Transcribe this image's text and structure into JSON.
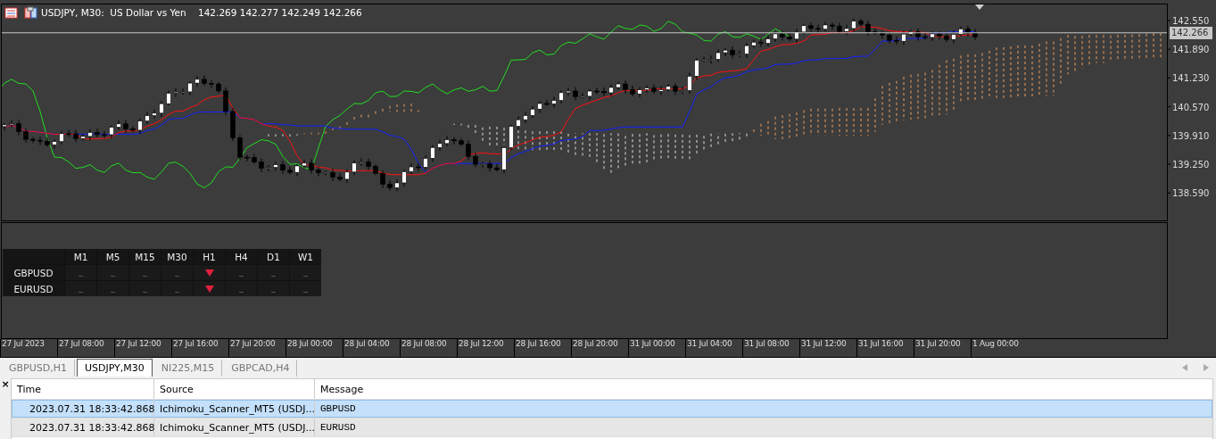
{
  "chart": {
    "title": "USDJPY, M30:  US Dollar vs Yen",
    "quotes": "142.269 142.277 142.249 142.266",
    "price_labels": [
      "142.550",
      "141.890",
      "141.230",
      "140.570",
      "139.910",
      "139.250",
      "138.590"
    ],
    "current_price": "142.266",
    "time_labels": [
      "27 Jul 2023",
      "27 Jul 08:00",
      "27 Jul 12:00",
      "27 Jul 16:00",
      "27 Jul 20:00",
      "28 Jul 00:00",
      "28 Jul 04:00",
      "28 Jul 08:00",
      "28 Jul 12:00",
      "28 Jul 16:00",
      "28 Jul 20:00",
      "31 Jul 00:00",
      "31 Jul 04:00",
      "31 Jul 08:00",
      "31 Jul 12:00",
      "31 Jul 16:00",
      "31 Jul 20:00",
      "1 Aug 00:00"
    ]
  },
  "scanner": {
    "columns": [
      "M1",
      "M5",
      "M15",
      "M30",
      "H1",
      "H4",
      "D1",
      "W1"
    ],
    "rows": [
      {
        "symbol": "GBPUSD",
        "cells": [
          {
            "kind": "empty",
            "text": "_"
          },
          {
            "kind": "empty",
            "text": "_"
          },
          {
            "kind": "empty",
            "text": "_"
          },
          {
            "kind": "empty",
            "text": "_"
          },
          {
            "kind": "down"
          },
          {
            "kind": "empty",
            "text": "_"
          },
          {
            "kind": "empty",
            "text": "_"
          },
          {
            "kind": "empty",
            "text": "_"
          }
        ]
      },
      {
        "symbol": "EURUSD",
        "cells": [
          {
            "kind": "empty",
            "text": "_"
          },
          {
            "kind": "empty",
            "text": "_"
          },
          {
            "kind": "empty",
            "text": "_"
          },
          {
            "kind": "empty",
            "text": "_"
          },
          {
            "kind": "down"
          },
          {
            "kind": "empty",
            "text": "_"
          },
          {
            "kind": "empty",
            "text": "_"
          },
          {
            "kind": "empty",
            "text": "_"
          }
        ]
      }
    ]
  },
  "tabs": [
    {
      "label": "GBPUSD,H1",
      "selected": false
    },
    {
      "label": "USDJPY,M30",
      "selected": true
    },
    {
      "label": "NI225,M15",
      "selected": false
    },
    {
      "label": "GBPCAD,H4",
      "selected": false
    }
  ],
  "log": {
    "close": "×",
    "columns": [
      "Time",
      "Source",
      "Message"
    ],
    "rows": [
      {
        "selected": true,
        "time": "2023.07.31 18:33:42.868",
        "source": "Ichimoku_Scanner_MT5 (USDJ...",
        "message": "GBPUSD"
      },
      {
        "selected": false,
        "time": "2023.07.31 18:33:42.868",
        "source": "Ichimoku_Scanner_MT5 (USDJ...",
        "message": "EURUSD"
      }
    ]
  }
}
